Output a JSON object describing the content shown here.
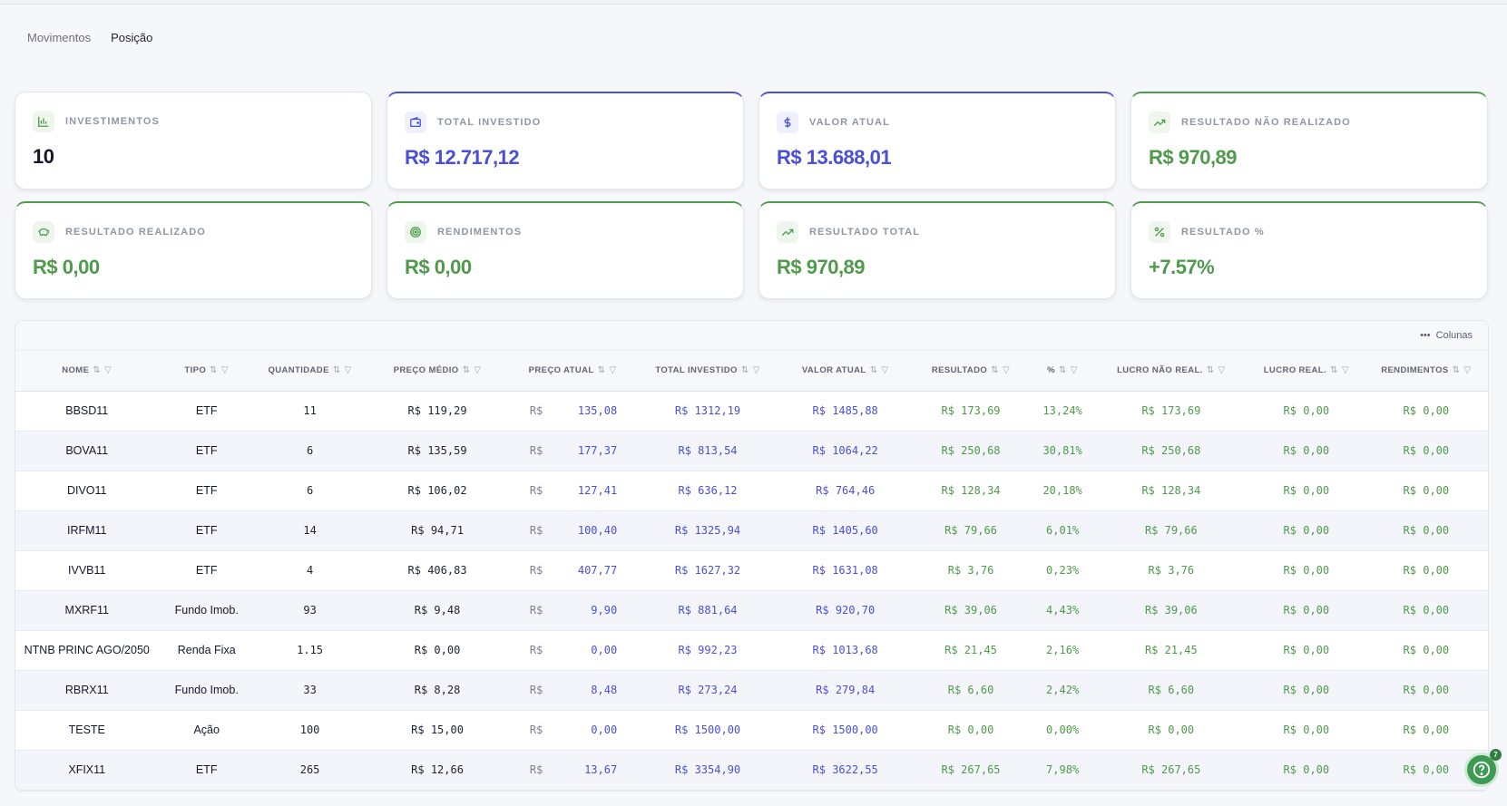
{
  "tabs": [
    {
      "label": "Movimentos",
      "active": false
    },
    {
      "label": "Posição",
      "active": true
    }
  ],
  "cards": [
    {
      "label": "INVESTIMENTOS",
      "value": "10",
      "icon": "bar-chart-icon",
      "accent": "plain",
      "value_color": "dark"
    },
    {
      "label": "TOTAL INVESTIDO",
      "value": "R$ 12.717,12",
      "icon": "wallet-icon",
      "accent": "blue",
      "value_color": "blue"
    },
    {
      "label": "VALOR ATUAL",
      "value": "R$ 13.688,01",
      "icon": "dollar-icon",
      "accent": "blue",
      "value_color": "blue"
    },
    {
      "label": "RESULTADO NÃO REALIZADO",
      "value": "R$ 970,89",
      "icon": "trending-up-icon",
      "accent": "green",
      "value_color": "green"
    },
    {
      "label": "RESULTADO REALIZADO",
      "value": "R$ 0,00",
      "icon": "piggy-bank-icon",
      "accent": "green",
      "value_color": "green"
    },
    {
      "label": "RENDIMENTOS",
      "value": "R$ 0,00",
      "icon": "target-icon",
      "accent": "green",
      "value_color": "green"
    },
    {
      "label": "RESULTADO TOTAL",
      "value": "R$ 970,89",
      "icon": "trending-up-icon",
      "accent": "green",
      "value_color": "green"
    },
    {
      "label": "RESULTADO %",
      "value": "+7.57%",
      "icon": "percent-icon",
      "accent": "green",
      "value_color": "green"
    }
  ],
  "toolbar": {
    "columns_label": "Colunas"
  },
  "table": {
    "columns": [
      "NOME",
      "TIPO",
      "QUANTIDADE",
      "PREÇO MÉDIO",
      "PREÇO ATUAL",
      "TOTAL INVESTIDO",
      "VALOR ATUAL",
      "RESULTADO",
      "%",
      "LUCRO NÃO REAL.",
      "LUCRO REAL.",
      "RENDIMENTOS"
    ],
    "price_prefix": "R$",
    "rows": [
      {
        "nome": "BBSD11",
        "tipo": "ETF",
        "quantidade": "11",
        "preco_medio": "R$ 119,29",
        "preco_atual": "135,08",
        "total_investido": "R$ 1312,19",
        "valor_atual": "R$ 1485,88",
        "resultado": "R$ 173,69",
        "pct": "13,24%",
        "lucro_nao_real": "R$ 173,69",
        "lucro_real": "R$ 0,00",
        "rendimentos": "R$ 0,00"
      },
      {
        "nome": "BOVA11",
        "tipo": "ETF",
        "quantidade": "6",
        "preco_medio": "R$ 135,59",
        "preco_atual": "177,37",
        "total_investido": "R$ 813,54",
        "valor_atual": "R$ 1064,22",
        "resultado": "R$ 250,68",
        "pct": "30,81%",
        "lucro_nao_real": "R$ 250,68",
        "lucro_real": "R$ 0,00",
        "rendimentos": "R$ 0,00"
      },
      {
        "nome": "DIVO11",
        "tipo": "ETF",
        "quantidade": "6",
        "preco_medio": "R$ 106,02",
        "preco_atual": "127,41",
        "total_investido": "R$ 636,12",
        "valor_atual": "R$ 764,46",
        "resultado": "R$ 128,34",
        "pct": "20,18%",
        "lucro_nao_real": "R$ 128,34",
        "lucro_real": "R$ 0,00",
        "rendimentos": "R$ 0,00"
      },
      {
        "nome": "IRFM11",
        "tipo": "ETF",
        "quantidade": "14",
        "preco_medio": "R$ 94,71",
        "preco_atual": "100,40",
        "total_investido": "R$ 1325,94",
        "valor_atual": "R$ 1405,60",
        "resultado": "R$ 79,66",
        "pct": "6,01%",
        "lucro_nao_real": "R$ 79,66",
        "lucro_real": "R$ 0,00",
        "rendimentos": "R$ 0,00"
      },
      {
        "nome": "IVVB11",
        "tipo": "ETF",
        "quantidade": "4",
        "preco_medio": "R$ 406,83",
        "preco_atual": "407,77",
        "total_investido": "R$ 1627,32",
        "valor_atual": "R$ 1631,08",
        "resultado": "R$ 3,76",
        "pct": "0,23%",
        "lucro_nao_real": "R$ 3,76",
        "lucro_real": "R$ 0,00",
        "rendimentos": "R$ 0,00"
      },
      {
        "nome": "MXRF11",
        "tipo": "Fundo Imob.",
        "quantidade": "93",
        "preco_medio": "R$ 9,48",
        "preco_atual": "9,90",
        "total_investido": "R$ 881,64",
        "valor_atual": "R$ 920,70",
        "resultado": "R$ 39,06",
        "pct": "4,43%",
        "lucro_nao_real": "R$ 39,06",
        "lucro_real": "R$ 0,00",
        "rendimentos": "R$ 0,00"
      },
      {
        "nome": "NTNB PRINC AGO/2050",
        "tipo": "Renda Fixa",
        "quantidade": "1.15",
        "preco_medio": "R$ 0,00",
        "preco_atual": "0,00",
        "total_investido": "R$ 992,23",
        "valor_atual": "R$ 1013,68",
        "resultado": "R$ 21,45",
        "pct": "2,16%",
        "lucro_nao_real": "R$ 21,45",
        "lucro_real": "R$ 0,00",
        "rendimentos": "R$ 0,00"
      },
      {
        "nome": "RBRX11",
        "tipo": "Fundo Imob.",
        "quantidade": "33",
        "preco_medio": "R$ 8,28",
        "preco_atual": "8,48",
        "total_investido": "R$ 273,24",
        "valor_atual": "R$ 279,84",
        "resultado": "R$ 6,60",
        "pct": "2,42%",
        "lucro_nao_real": "R$ 6,60",
        "lucro_real": "R$ 0,00",
        "rendimentos": "R$ 0,00"
      },
      {
        "nome": "TESTE",
        "tipo": "Ação",
        "quantidade": "100",
        "preco_medio": "R$ 15,00",
        "preco_atual": "0,00",
        "total_investido": "R$ 1500,00",
        "valor_atual": "R$ 1500,00",
        "resultado": "R$ 0,00",
        "pct": "0,00%",
        "lucro_nao_real": "R$ 0,00",
        "lucro_real": "R$ 0,00",
        "rendimentos": "R$ 0,00"
      },
      {
        "nome": "XFIX11",
        "tipo": "ETF",
        "quantidade": "265",
        "preco_medio": "R$ 12,66",
        "preco_atual": "13,67",
        "total_investido": "R$ 3354,90",
        "valor_atual": "R$ 3622,55",
        "resultado": "R$ 267,65",
        "pct": "7,98%",
        "lucro_nao_real": "R$ 267,65",
        "lucro_real": "R$ 0,00",
        "rendimentos": "R$ 0,00"
      }
    ]
  },
  "help": {
    "badge": "7",
    "icon": "help-circle-icon"
  },
  "colors": {
    "accent_blue": "#4a4fd6",
    "accent_green": "#4f9a4b",
    "help_green": "#3d9a52"
  }
}
